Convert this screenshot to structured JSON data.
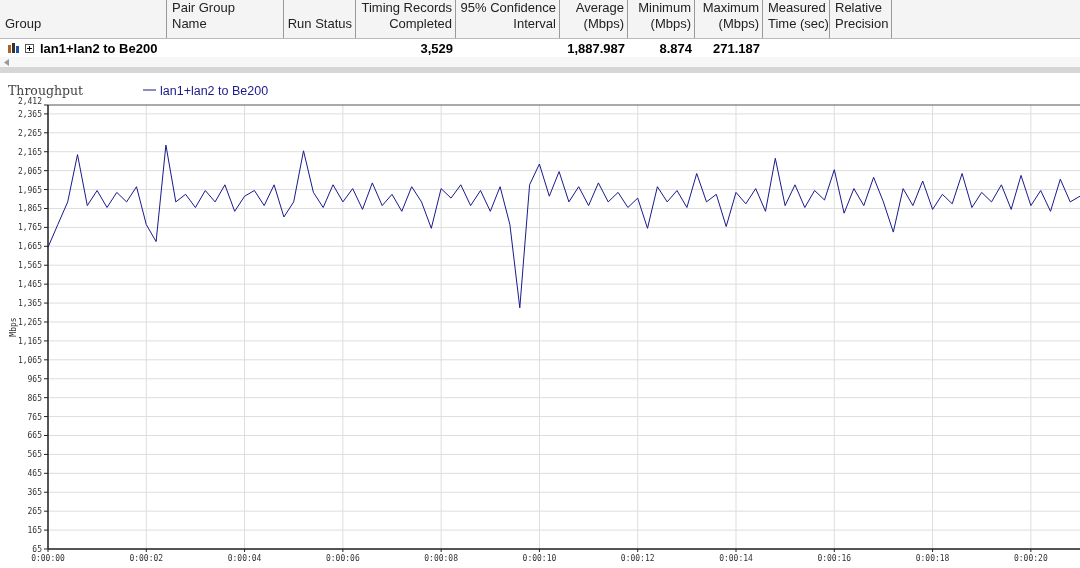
{
  "table": {
    "columns": [
      {
        "lines": [
          "Group"
        ]
      },
      {
        "lines": [
          "Pair Group",
          "Name"
        ]
      },
      {
        "lines": [
          "Run Status"
        ]
      },
      {
        "lines": [
          "Timing Records",
          "Completed"
        ]
      },
      {
        "lines": [
          "95% Confidence",
          "Interval"
        ]
      },
      {
        "lines": [
          "Average",
          "(Mbps)"
        ]
      },
      {
        "lines": [
          "Minimum",
          "(Mbps)"
        ]
      },
      {
        "lines": [
          "Maximum",
          "(Mbps)"
        ]
      },
      {
        "lines": [
          "Measured",
          "Time (sec)"
        ]
      },
      {
        "lines": [
          "Relative",
          "Precision"
        ]
      }
    ],
    "rows": [
      {
        "expanded": false,
        "cells": [
          "lan1+lan2 to Be200",
          "",
          "",
          "3,529",
          "",
          "1,887.987",
          "8.874",
          "271.187",
          "",
          ""
        ]
      }
    ]
  },
  "chart": {
    "chart_data": {
      "type": "line",
      "grid": true,
      "title": "Throughput",
      "ylabel": "Mbps",
      "xlim": [
        0,
        21
      ],
      "ylim": [
        65,
        2412
      ],
      "xticks": [
        {
          "value": 0,
          "label": "0:00:00"
        },
        {
          "value": 2,
          "label": "0:00:02"
        },
        {
          "value": 4,
          "label": "0:00:04"
        },
        {
          "value": 6,
          "label": "0:00:06"
        },
        {
          "value": 8,
          "label": "0:00:08"
        },
        {
          "value": 10,
          "label": "0:00:10"
        },
        {
          "value": 12,
          "label": "0:00:12"
        },
        {
          "value": 14,
          "label": "0:00:14"
        },
        {
          "value": 16,
          "label": "0:00:16"
        },
        {
          "value": 18,
          "label": "0:00:18"
        },
        {
          "value": 20,
          "label": "0:00:20"
        }
      ],
      "yticks": [
        {
          "value": 65,
          "label": "65"
        },
        {
          "value": 165,
          "label": "165"
        },
        {
          "value": 265,
          "label": "265"
        },
        {
          "value": 365,
          "label": "365"
        },
        {
          "value": 465,
          "label": "465"
        },
        {
          "value": 565,
          "label": "565"
        },
        {
          "value": 665,
          "label": "665"
        },
        {
          "value": 765,
          "label": "765"
        },
        {
          "value": 865,
          "label": "865"
        },
        {
          "value": 965,
          "label": "965"
        },
        {
          "value": 1065,
          "label": "1,065"
        },
        {
          "value": 1165,
          "label": "1,165"
        },
        {
          "value": 1265,
          "label": "1,265"
        },
        {
          "value": 1365,
          "label": "1,365"
        },
        {
          "value": 1465,
          "label": "1,465"
        },
        {
          "value": 1565,
          "label": "1,565"
        },
        {
          "value": 1665,
          "label": "1,665"
        },
        {
          "value": 1765,
          "label": "1,765"
        },
        {
          "value": 1865,
          "label": "1,865"
        },
        {
          "value": 1965,
          "label": "1,965"
        },
        {
          "value": 2065,
          "label": "2,065"
        },
        {
          "value": 2165,
          "label": "2,165"
        },
        {
          "value": 2265,
          "label": "2,265"
        },
        {
          "value": 2365,
          "label": "2,365"
        },
        {
          "value": 2412,
          "label": "2,412"
        }
      ],
      "x": [
        0,
        0.2,
        0.4,
        0.6,
        0.8,
        1,
        1.2,
        1.4,
        1.6,
        1.8,
        2,
        2.2,
        2.4,
        2.6,
        2.8,
        3,
        3.2,
        3.4,
        3.6,
        3.8,
        4,
        4.2,
        4.4,
        4.6,
        4.8,
        5,
        5.2,
        5.4,
        5.6,
        5.8,
        6,
        6.2,
        6.4,
        6.6,
        6.8,
        7,
        7.2,
        7.4,
        7.6,
        7.8,
        8,
        8.2,
        8.4,
        8.6,
        8.8,
        9,
        9.2,
        9.4,
        9.6,
        9.8,
        10,
        10.2,
        10.4,
        10.6,
        10.8,
        11,
        11.2,
        11.4,
        11.6,
        11.8,
        12,
        12.2,
        12.4,
        12.6,
        12.8,
        13,
        13.2,
        13.4,
        13.6,
        13.8,
        14,
        14.2,
        14.4,
        14.6,
        14.8,
        15,
        15.2,
        15.4,
        15.6,
        15.8,
        16,
        16.2,
        16.4,
        16.6,
        16.8,
        17,
        17.2,
        17.4,
        17.6,
        17.8,
        18,
        18.2,
        18.4,
        18.6,
        18.8,
        19,
        19.2,
        19.4,
        19.6,
        19.8,
        20,
        20.2,
        20.4,
        20.6,
        20.8,
        21
      ],
      "series": [
        {
          "name": "lan1+lan2 to Be200",
          "color": "#1a1a8c",
          "values": [
            1660,
            1780,
            1900,
            2150,
            1880,
            1960,
            1870,
            1950,
            1900,
            1980,
            1780,
            1690,
            2200,
            1900,
            1940,
            1870,
            1960,
            1900,
            1990,
            1850,
            1930,
            1960,
            1880,
            1990,
            1820,
            1900,
            2170,
            1950,
            1870,
            1990,
            1900,
            1970,
            1860,
            2000,
            1880,
            1940,
            1850,
            1980,
            1900,
            1760,
            1970,
            1920,
            1990,
            1880,
            1960,
            1850,
            1980,
            1780,
            1340,
            1990,
            2100,
            1930,
            2060,
            1900,
            1980,
            1880,
            2000,
            1900,
            1950,
            1870,
            1920,
            1760,
            1980,
            1900,
            1960,
            1870,
            2050,
            1900,
            1940,
            1770,
            1950,
            1890,
            1970,
            1850,
            2130,
            1880,
            1990,
            1870,
            1960,
            1910,
            2070,
            1840,
            1970,
            1880,
            2030,
            1900,
            1740,
            1970,
            1880,
            2010,
            1860,
            1940,
            1890,
            2050,
            1870,
            1950,
            1900,
            1990,
            1860,
            2040,
            1880,
            1960,
            1850,
            2020,
            1900,
            1930
          ]
        }
      ]
    }
  }
}
